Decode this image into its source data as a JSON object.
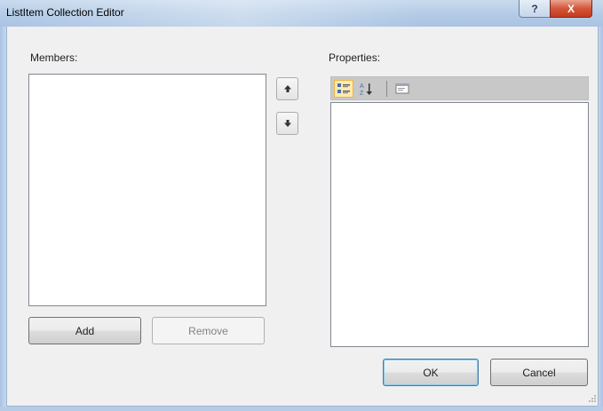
{
  "window": {
    "title": "ListItem Collection Editor",
    "help_label": "?",
    "close_label": "X"
  },
  "members": {
    "label": "Members:",
    "items": []
  },
  "properties": {
    "label": "Properties:",
    "toolbar": [
      "categorized-icon",
      "alphabetical-icon",
      "property-pages-icon"
    ]
  },
  "buttons": {
    "add": "Add",
    "remove": "Remove",
    "ok": "OK",
    "cancel": "Cancel",
    "move_up": "move-up-icon",
    "move_down": "move-down-icon"
  },
  "colors": {
    "titlebar": "#b3cbe6",
    "client": "#f0f0f0",
    "close_button": "#c43a1e",
    "default_button_border": "#3c7fb1"
  }
}
